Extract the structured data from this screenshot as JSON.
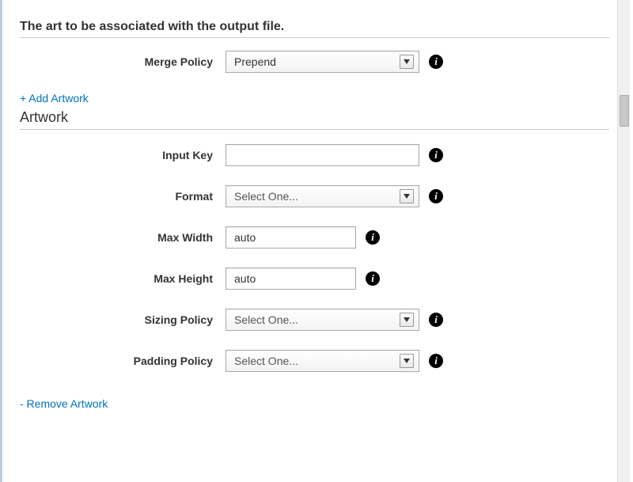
{
  "header": {
    "description": "The art to be associated with the output file."
  },
  "mergePolicy": {
    "label": "Merge Policy",
    "value": "Prepend"
  },
  "links": {
    "addArtwork": "+ Add Artwork",
    "removeArtwork": "- Remove Artwork"
  },
  "artwork": {
    "heading": "Artwork",
    "inputKey": {
      "label": "Input Key",
      "value": ""
    },
    "format": {
      "label": "Format",
      "value": "Select One..."
    },
    "maxWidth": {
      "label": "Max Width",
      "value": "auto"
    },
    "maxHeight": {
      "label": "Max Height",
      "value": "auto"
    },
    "sizingPolicy": {
      "label": "Sizing Policy",
      "value": "Select One..."
    },
    "paddingPolicy": {
      "label": "Padding Policy",
      "value": "Select One..."
    }
  }
}
